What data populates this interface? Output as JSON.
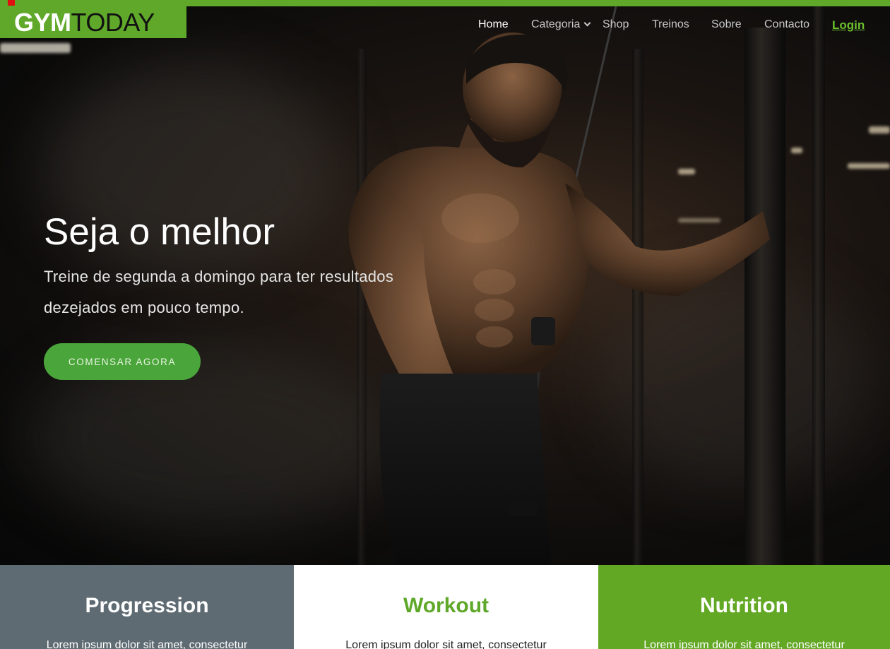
{
  "brand": {
    "name_bold": "GYM",
    "name_light": "TODAY"
  },
  "nav": {
    "items": [
      "Home",
      "Categoria",
      "Shop",
      "Treinos",
      "Sobre",
      "Contacto"
    ],
    "login": "Login"
  },
  "hero": {
    "title": "Seja o melhor",
    "subtitle": "Treine de segunda a domingo para ter resultados dezejados em pouco tempo.",
    "cta_label": "COMENSAR AGORA"
  },
  "features": [
    {
      "title": "Progression",
      "text": "Lorem ipsum dolor sit amet, consectetur"
    },
    {
      "title": "Workout",
      "text": "Lorem ipsum dolor sit amet, consectetur"
    },
    {
      "title": "Nutrition",
      "text": "Lorem ipsum dolor sit amet, consectetur"
    }
  ],
  "colors": {
    "brand_green": "#5fa82a",
    "cta_green": "#4aa63a",
    "slate": "#5f6b73"
  }
}
